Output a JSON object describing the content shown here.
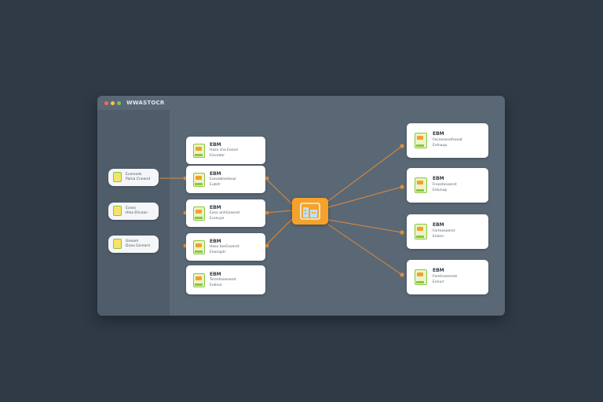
{
  "window": {
    "title": "WWASTOCR"
  },
  "colors": {
    "dot_red": "#f26b5b",
    "dot_yellow": "#f4c542",
    "dot_green": "#7cc35a",
    "accent": "#f5a22a",
    "link": "#e08a3a",
    "icon_green": "#8cc63f"
  },
  "sidebar_items": [
    {
      "line1": "Ecemeds",
      "line2": "Pama Cneand"
    },
    {
      "line1": "Ecexs",
      "line2": "Hlex Ehcoan"
    },
    {
      "line1": "Gneam",
      "line2": "Dvau Gsreard"
    }
  ],
  "left_nodes": [
    {
      "title": "EBM",
      "line1": "Haso cha Eesed",
      "line2": "Eisceder"
    },
    {
      "title": "EBM",
      "line1": "Easoeblsetosar",
      "line2": "Eubrtr"
    },
    {
      "title": "EBM",
      "line1": "Easo anhGsoeret",
      "line2": "Eureuye"
    },
    {
      "title": "EBM",
      "line1": "Haso toeGsoeret",
      "line2": "Eeonaptr"
    },
    {
      "title": "EBM",
      "line1": "Tsronhsosoerot",
      "line2": "Eebnur"
    }
  ],
  "right_nodes": [
    {
      "title": "EBM",
      "line1": "Fecnesonefsoeat",
      "line2": "Eelnaup"
    },
    {
      "title": "EBM",
      "line1": "Frosetosoeret",
      "line2": "Eelunup"
    },
    {
      "title": "EBM",
      "line1": "Forteosoeret",
      "line2": "Eelonr"
    },
    {
      "title": "EBM",
      "line1": "Faretconeroet",
      "line2": "Eenurr"
    }
  ],
  "hub": {
    "icon": "building-icon"
  }
}
